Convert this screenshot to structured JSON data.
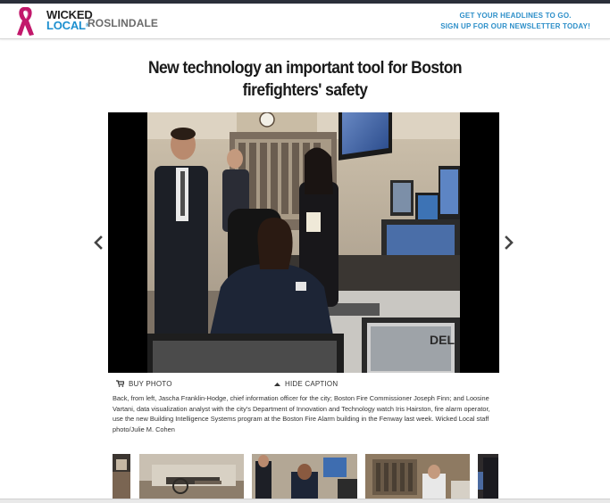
{
  "header": {
    "logo_wicked": "WICKED",
    "logo_local": "LOCAL",
    "logo_town": "ROSLINDALE",
    "promo_line1": "GET YOUR HEADLINES TO GO.",
    "promo_line2": "SIGN UP FOR OUR NEWSLETTER TODAY!"
  },
  "article": {
    "title": "New technology an important tool for Boston firefighters' safety"
  },
  "gallery": {
    "buy_photo_label": "BUY PHOTO",
    "hide_caption_label": "HIDE CAPTION",
    "caption": "Back, from left, Jascha Franklin-Hodge, chief information officer for the city; Boston Fire Commissioner Joseph Finn; and Loosine Vartani, data visualization analyst with the city's Department of Innovation and Technology watch Iris Hairston, fire alarm operator, use the new Building Intelligence Systems program at the Boston Fire Alarm building in the Fenway last week. Wicked Local staff photo/Julie M. Cohen"
  },
  "colors": {
    "brand_blue": "#1c8fcf",
    "ribbon_pink": "#c2186b",
    "topbar": "#2b2f3a"
  },
  "icons": [
    "pink-ribbon-icon",
    "chevron-left-icon",
    "chevron-right-icon",
    "cart-icon",
    "caret-up-icon"
  ]
}
